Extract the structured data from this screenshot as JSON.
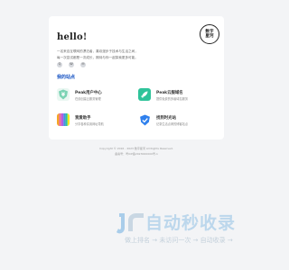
{
  "profile": {
    "greeting": "hello!",
    "intro_line1": "一名来自互联网的漂泊者，喜欢漫步于技术与生活之间，",
    "intro_line2": "每一次尝试都是一次成长，期待与你一起探索更多可能。",
    "logo_line1": "数字",
    "logo_line2": "星河",
    "social": [
      {
        "icon": "qq-icon",
        "glyph": "Q"
      },
      {
        "icon": "wechat-icon",
        "glyph": "W"
      },
      {
        "icon": "email-icon",
        "glyph": "✉"
      }
    ]
  },
  "sites_section": {
    "title": "我的站点",
    "items": [
      {
        "name": "Peak用户中心",
        "desc": "在线创建云服务管理",
        "icon": "yen-shield-icon",
        "color": "#7bd3b4"
      },
      {
        "name": "Peak云服域名",
        "desc": "提供免费的多级域名服务",
        "icon": "rocket-icon",
        "color": "#2fc39a"
      },
      {
        "name": "我爱助手",
        "desc": "分享各种实用网址导航",
        "icon": "color-stripes-icon",
        "color": "#e86aa0"
      },
      {
        "name": "找到时光站",
        "desc": "记录生活点滴的博客站点",
        "icon": "shield-check-icon",
        "color": "#2f80ed"
      }
    ]
  },
  "footer": {
    "copyright": "Copyright © 2016 - 2023 数字星河 All Rights Reserved.",
    "icp": "备案号：粤ICP备2023000000号-1"
  },
  "watermark": {
    "title": "自动秒收录",
    "subtitle": "做上排名 → 未访问一次 → 自动收录 →"
  },
  "colors": {
    "accent": "#1a56c4",
    "background": "#f3f4f6"
  }
}
